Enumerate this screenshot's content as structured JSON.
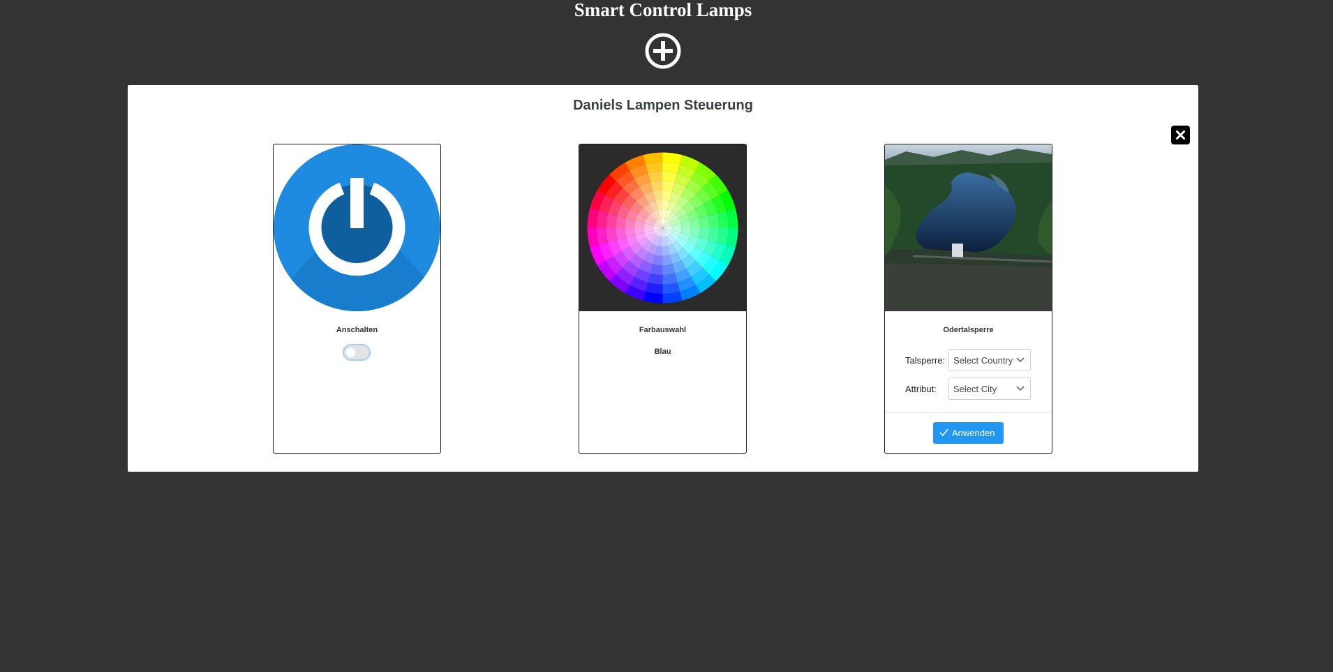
{
  "header": {
    "title": "Smart Control Lamps",
    "add_icon": "plus-circle-icon"
  },
  "panel": {
    "title": "Daniels Lampen Steuerung",
    "close_icon": "close-icon"
  },
  "cards": {
    "power": {
      "icon": "power-icon",
      "title": "Anschalten",
      "toggle_on": false,
      "accent": "#1e8ae0"
    },
    "color": {
      "icon": "color-wheel-icon",
      "title": "Farbauswahl",
      "selected_color": "Blau"
    },
    "dam": {
      "image": "reservoir-photo",
      "title": "Odertalsperre",
      "fields": [
        {
          "label": "Talsperre:",
          "placeholder": "Select Country"
        },
        {
          "label": "Attribut:",
          "placeholder": "Select City"
        }
      ],
      "apply_label": "Anwenden",
      "button_color": "#2196f3"
    }
  }
}
